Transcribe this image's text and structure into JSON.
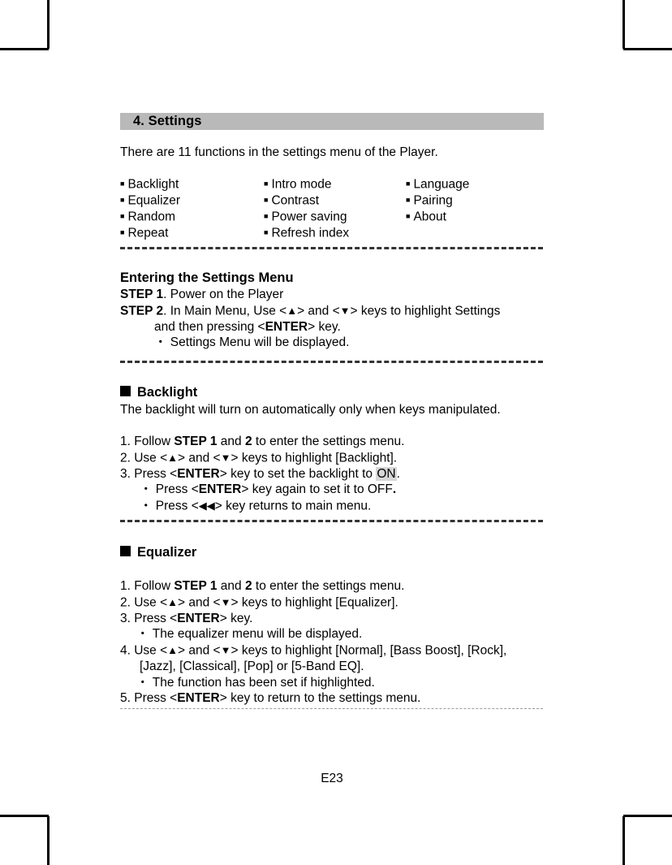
{
  "document": {
    "page_number_label": "E23",
    "chapter_title": "4. Settings",
    "intro_text": "There are 11 functions in the settings menu of the Player.",
    "colors": {
      "chapter_bar": "#b9b9b9",
      "rule_dark": "#333333",
      "rule_light": "#9a9a9a",
      "highlight": "#d7d7d7"
    }
  },
  "feature_list": {
    "columns": [
      {
        "items": [
          "Backlight",
          "Equalizer",
          "Random",
          "Repeat"
        ]
      },
      {
        "items": [
          "Intro mode",
          "Contrast",
          "Power saving",
          "Refresh index"
        ]
      },
      {
        "items": [
          "Language",
          "Pairing",
          "About"
        ]
      }
    ]
  },
  "entering_section": {
    "heading": "Entering the Settings Menu",
    "step1_label": "STEP 1",
    "step1_text": ". Power on the Player",
    "step2_label": "STEP 2",
    "step2_text_a": ". In Main Menu, Use <",
    "step2_up": "▲",
    "step2_text_b": "> and <",
    "step2_down": "▼",
    "step2_text_c": "> keys to highlight Settings",
    "step2_cont_a": "and then pressing <",
    "step2_enter": "ENTER",
    "step2_cont_b": "> key.",
    "note": "・ Settings Menu will be displayed."
  },
  "backlight_section": {
    "heading": "Backlight",
    "description": "The backlight will turn on automatically only when keys manipulated.",
    "step1_a": "1. Follow ",
    "step1_b": "STEP 1",
    "step1_c": " and ",
    "step1_d": "2",
    "step1_e": " to enter the settings menu.",
    "step2_a": "2. Use <",
    "step2_up": "▲",
    "step2_b": "> and <",
    "step2_down": "▼",
    "step2_c": "> keys to highlight [Backlight].",
    "step3_a": "3. Press <",
    "step3_enter": "ENTER",
    "step3_b": "> key to set the backlight to ",
    "step3_highlight": "ON",
    "step3_c": ".",
    "note1_a": "・ Press <",
    "note1_enter": "ENTER",
    "note1_b": "> key again to set it to OFF",
    "note1_c": ".",
    "note2_a": "・ Press <",
    "note2_arrows": "◀◀",
    "note2_b": "> key returns to main menu."
  },
  "equalizer_section": {
    "heading": "Equalizer",
    "step1_a": "1. Follow ",
    "step1_b": "STEP 1",
    "step1_c": " and ",
    "step1_d": "2",
    "step1_e": " to enter the settings menu.",
    "step2_a": "2. Use <",
    "step2_up": "▲",
    "step2_b": "> and <",
    "step2_down": "▼",
    "step2_c": "> keys to highlight [Equalizer].",
    "step3_a": "3. Press <",
    "step3_enter": "ENTER",
    "step3_b": "> key.",
    "note1": "・ The equalizer menu will be displayed.",
    "step4_a": "4. Use <",
    "step4_up": "▲",
    "step4_b": "> and <",
    "step4_down": "▼",
    "step4_c": "> keys to highlight [Normal], [Bass Boost], [Rock],",
    "step4_cont": "[Jazz], [Classical], [Pop] or [5-Band EQ].",
    "note2": "・ The function has been set if highlighted.",
    "step5_a": "5. Press <",
    "step5_enter": "ENTER",
    "step5_b": "> key to return to the settings menu."
  }
}
